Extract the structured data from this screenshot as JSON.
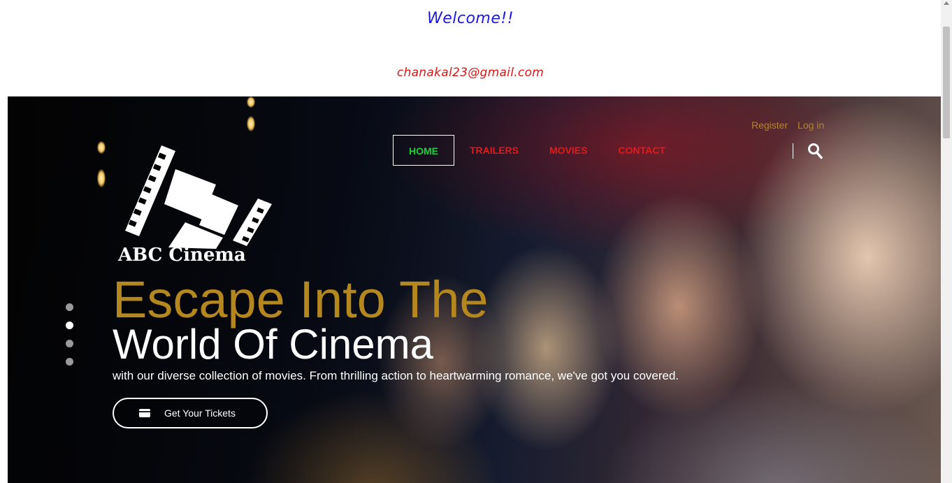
{
  "header": {
    "welcome": "Welcome!!",
    "email": "chanakal23@gmail.com"
  },
  "auth": {
    "register": "Register",
    "login": "Log in"
  },
  "nav": {
    "items": [
      {
        "label": "HOME",
        "active": true
      },
      {
        "label": "TRAILERS",
        "active": false
      },
      {
        "label": "MOVIES",
        "active": false
      },
      {
        "label": "CONTACT",
        "active": false
      }
    ]
  },
  "brand": {
    "name": "ABC Cinema"
  },
  "hero": {
    "headline_line1": "Escape Into The",
    "headline_line2": "World Of Cinema",
    "tagline": "with our diverse collection of movies. From thrilling action to heartwarming romance, we've got you covered.",
    "cta_label": "Get Your Tickets",
    "slides": 4,
    "active_slide": 2
  },
  "icons": {
    "search": "search-icon",
    "logo": "film-strip-icon",
    "ticket": "ticket-icon"
  },
  "colors": {
    "welcome": "#1a1ae0",
    "email": "#e01515",
    "nav_link": "#e21a1a",
    "nav_active": "#1ed13a",
    "headline_gold": "#b5871f",
    "auth_link": "#b5842a"
  }
}
